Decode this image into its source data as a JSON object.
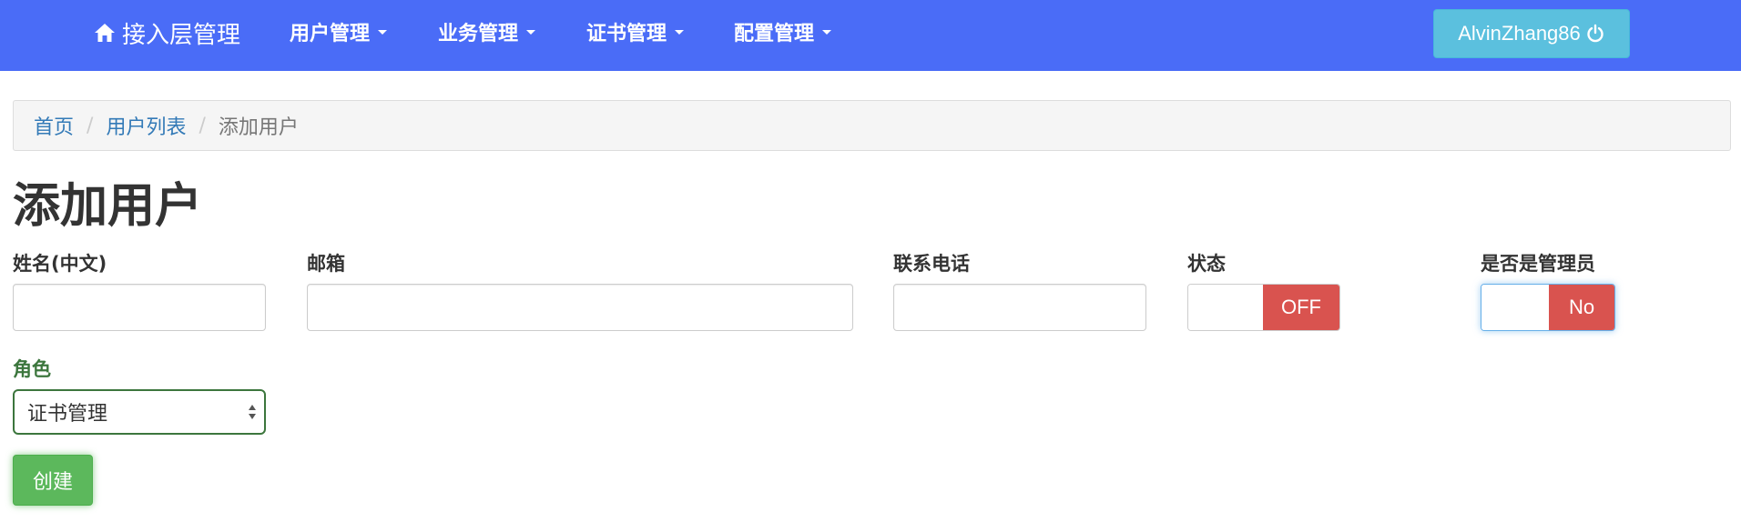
{
  "navbar": {
    "brand_label": "接入层管理",
    "brand_icon": "home-icon",
    "bg_color": "#4a6cf7",
    "menus": [
      {
        "label": "用户管理"
      },
      {
        "label": "业务管理"
      },
      {
        "label": "证书管理"
      },
      {
        "label": "配置管理"
      }
    ],
    "user": {
      "label": "AlvinZhang86",
      "icon": "power-icon",
      "color": "#5bc0de"
    }
  },
  "breadcrumb": {
    "items": [
      {
        "label": "首页"
      },
      {
        "label": "用户列表"
      },
      {
        "label": "添加用户"
      }
    ],
    "separator": "/"
  },
  "page": {
    "title": "添加用户"
  },
  "form": {
    "name": {
      "label": "姓名(中文)",
      "value": ""
    },
    "email": {
      "label": "邮箱",
      "value": ""
    },
    "phone": {
      "label": "联系电话",
      "value": ""
    },
    "status": {
      "label": "状态",
      "value": "OFF",
      "color": "#d9534f"
    },
    "is_admin": {
      "label": "是否是管理员",
      "value": "No",
      "color": "#d9534f"
    },
    "role": {
      "label": "角色",
      "selected": "证书管理"
    },
    "submit_label": "创建",
    "submit_color": "#5cb85c"
  }
}
